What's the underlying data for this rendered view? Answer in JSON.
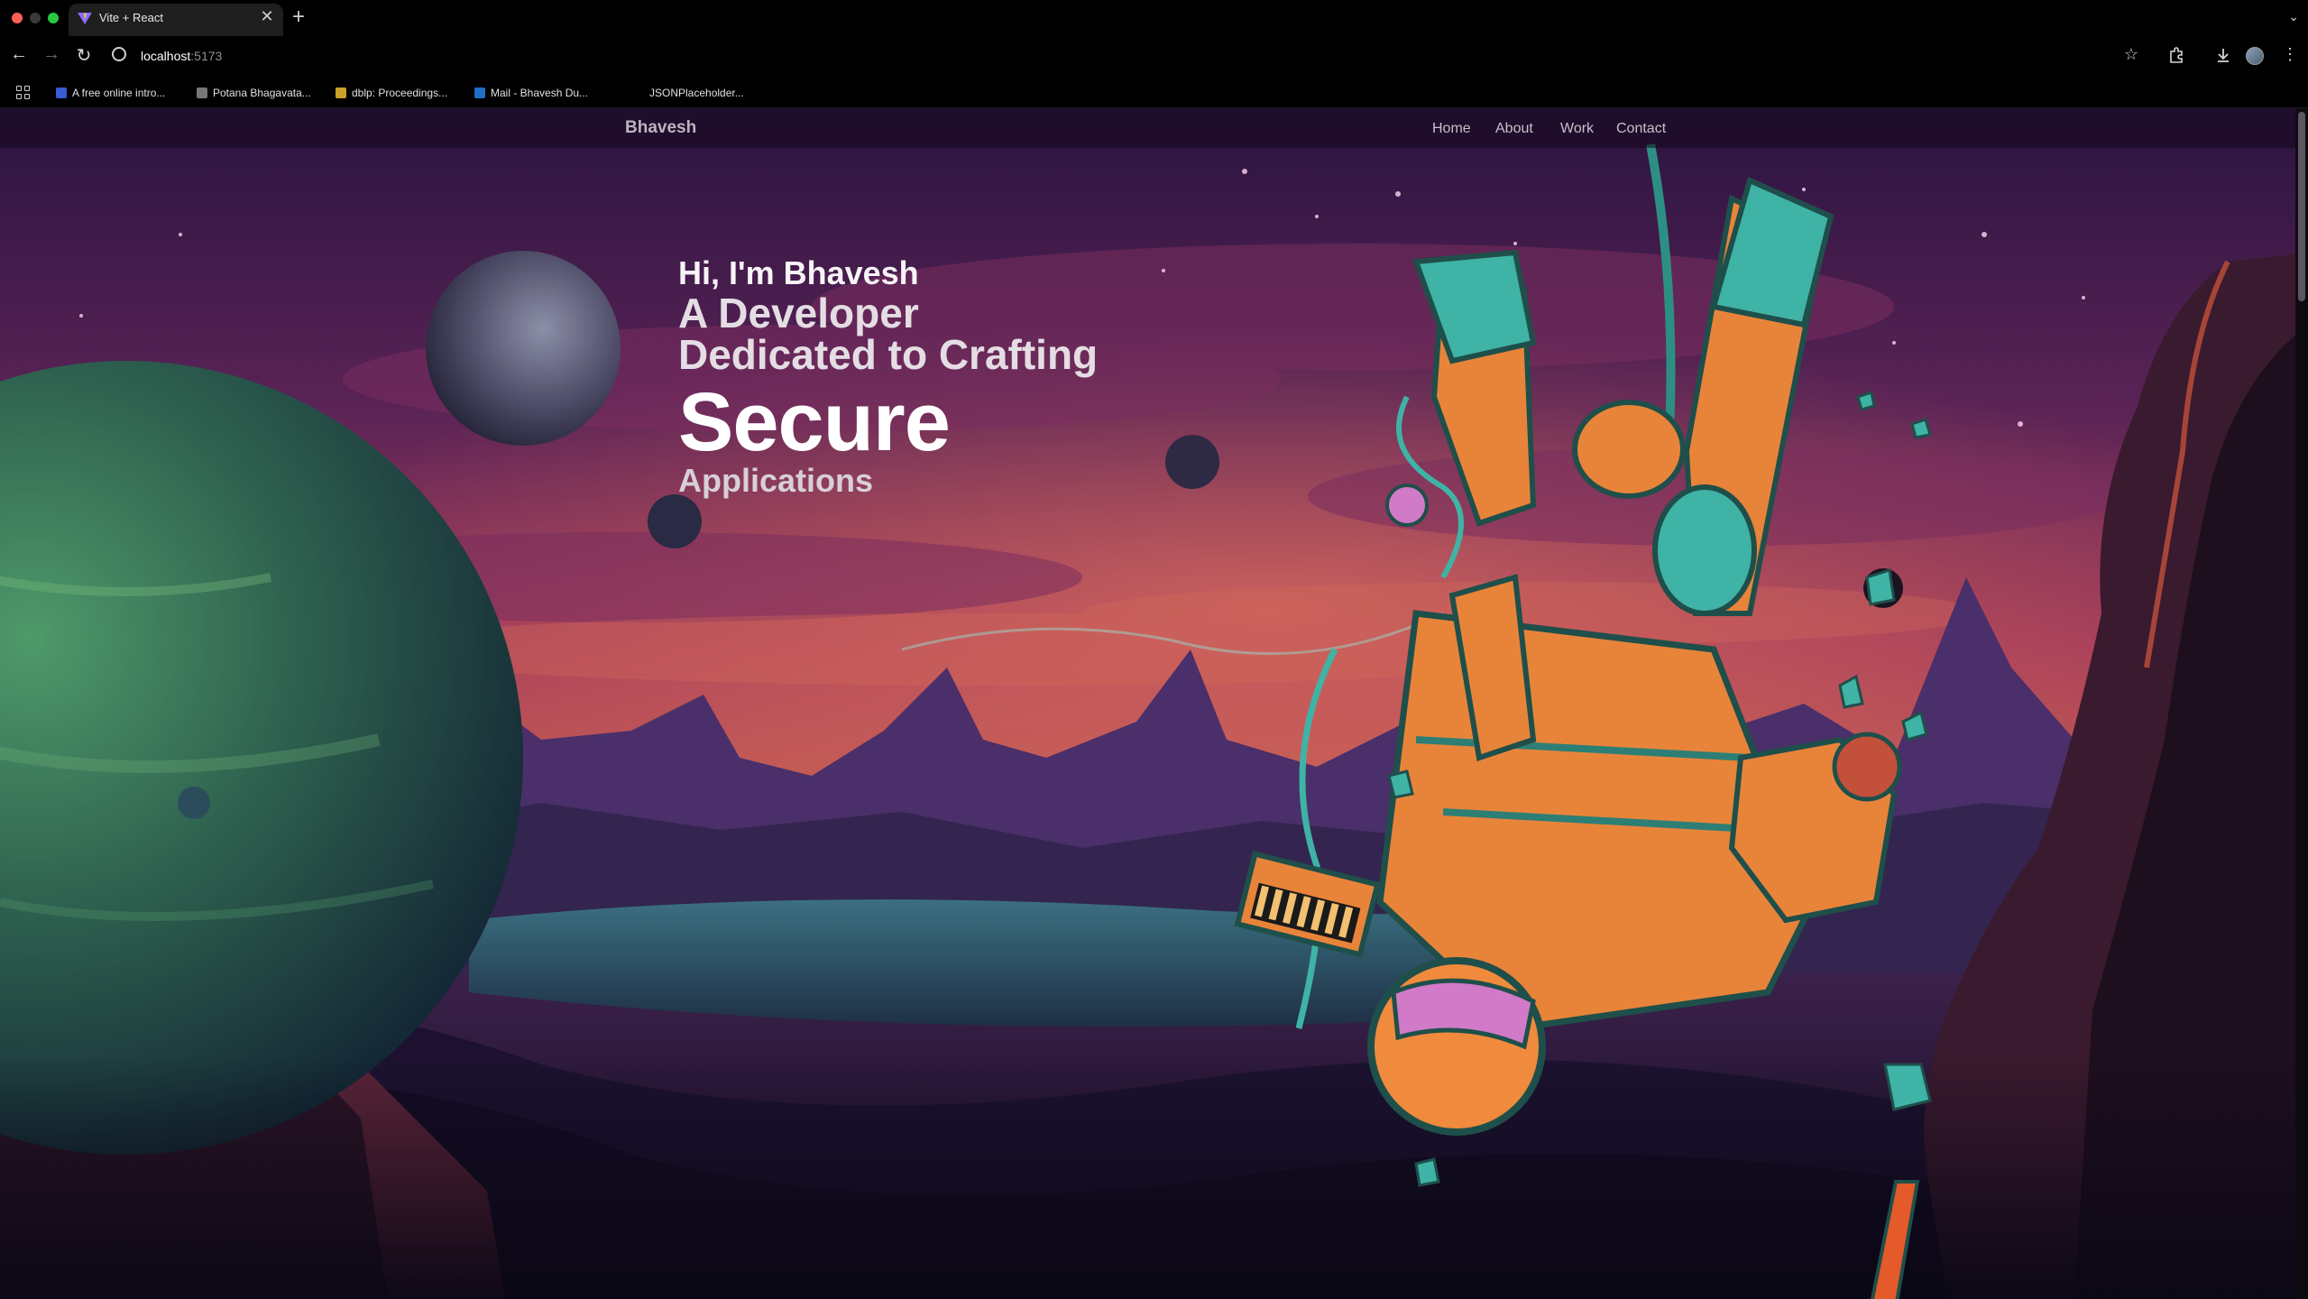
{
  "browser": {
    "tab_title": "Vite + React",
    "tab_close": "✕",
    "new_tab": "+",
    "url_host": "localhost",
    "url_port": ":5173",
    "bookmarks": [
      {
        "label": "A free online intro...",
        "color": "#3b5bd6"
      },
      {
        "label": "Potana Bhagavata...",
        "color": "#777777"
      },
      {
        "label": "dblp: Proceedings...",
        "color": "#c9a227"
      },
      {
        "label": "Mail - Bhavesh Du...",
        "color": "#1f6fc6"
      },
      {
        "label": "JSONPlaceholder...",
        "color": "#000000"
      }
    ]
  },
  "site": {
    "brand": "Bhavesh",
    "nav": [
      "Home",
      "About",
      "Work",
      "Contact"
    ],
    "hero": {
      "greeting": "Hi, I'm Bhavesh",
      "line1": "A Developer",
      "line2": "Dedicated to Crafting",
      "highlight": "Secure",
      "line3": "Applications"
    }
  },
  "colors": {
    "sky_top": "#2a1440",
    "sky_mid": "#a23a5a",
    "horizon": "#d86a4a",
    "ground": "#140c24",
    "suit_orange": "#e8843a",
    "suit_teal": "#3fb3a5"
  },
  "icons": [
    "back-arrow-icon",
    "forward-arrow-icon",
    "reload-icon",
    "site-info-icon",
    "star-icon",
    "extensions-icon",
    "download-icon",
    "menu-icon",
    "apps-grid-icon"
  ]
}
